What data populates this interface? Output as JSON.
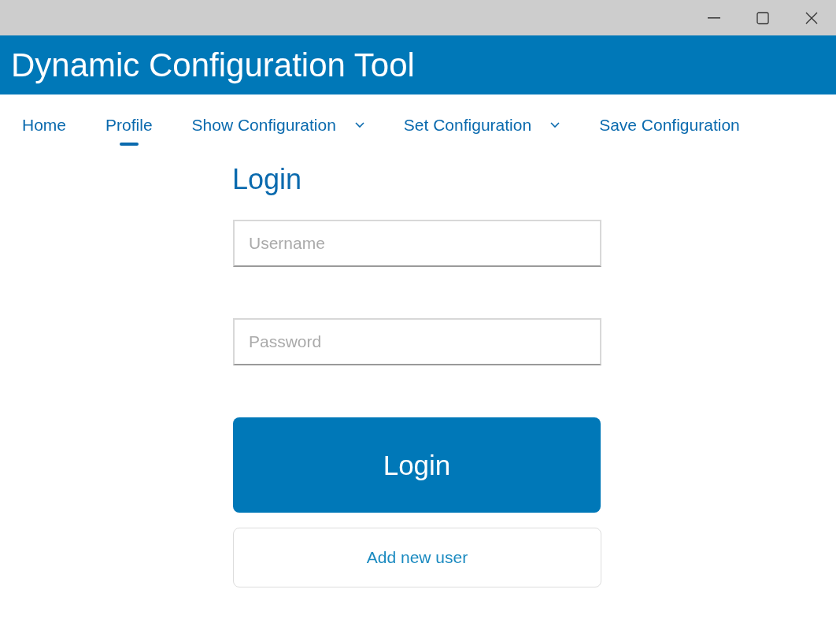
{
  "app_header": {
    "title": "Dynamic Configuration Tool"
  },
  "nav": [
    {
      "label": "Home",
      "kind": "link",
      "selected": false
    },
    {
      "label": "Profile",
      "kind": "link",
      "selected": true
    },
    {
      "label": "Show Configuration",
      "kind": "dropdown",
      "selected": false
    },
    {
      "label": "Set Configuration",
      "kind": "dropdown",
      "selected": false
    },
    {
      "label": "Save Configuration",
      "kind": "link",
      "selected": false
    }
  ],
  "login": {
    "heading": "Login",
    "fields": [
      {
        "placeholder": "Username"
      },
      {
        "placeholder": "Password"
      }
    ],
    "login_button": "Login",
    "add_user_button": "Add new user"
  }
}
